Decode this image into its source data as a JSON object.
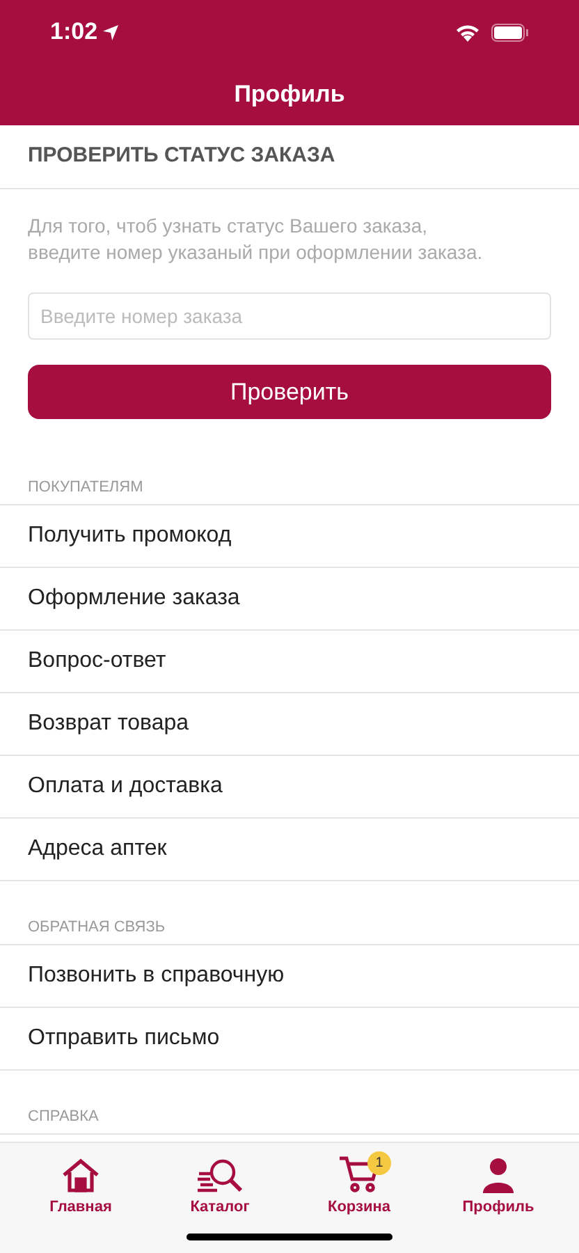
{
  "status_bar": {
    "time": "1:02"
  },
  "header": {
    "title": "Профиль"
  },
  "order_check": {
    "title": "ПРОВЕРИТЬ СТАТУС ЗАКАЗА",
    "description": "Для того, чтоб узнать статус Вашего заказа, введите номер указаный при оформлении заказа.",
    "placeholder": "Введите номер заказа",
    "button": "Проверить"
  },
  "sections": [
    {
      "title": "ПОКУПАТЕЛЯМ",
      "items": [
        "Получить промокод",
        "Оформление заказа",
        "Вопрос-ответ",
        "Возврат товара",
        "Оплата и доставка",
        "Адреса аптек"
      ]
    },
    {
      "title": "ОБРАТНАЯ СВЯЗЬ",
      "items": [
        "Позвонить в справочную",
        "Отправить письмо"
      ]
    },
    {
      "title": "СПРАВКА"
    }
  ],
  "tab_bar": [
    {
      "kind": "home",
      "label": "Главная"
    },
    {
      "kind": "catalog",
      "label": "Каталог"
    },
    {
      "kind": "cart",
      "label": "Корзина",
      "badge": "1"
    },
    {
      "kind": "profile",
      "label": "Профиль"
    }
  ]
}
